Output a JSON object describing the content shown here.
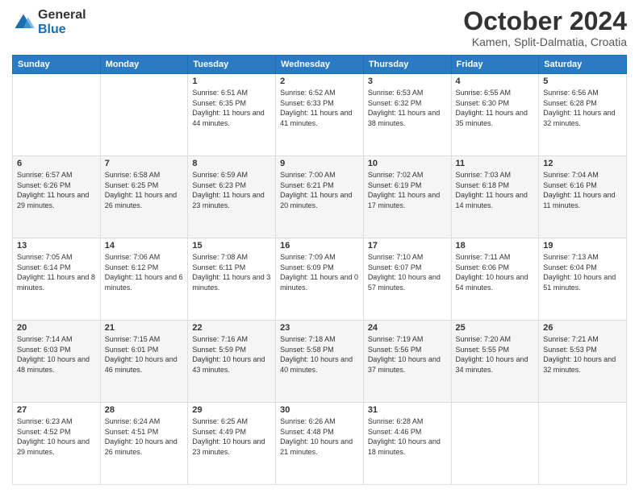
{
  "logo": {
    "general": "General",
    "blue": "Blue"
  },
  "header": {
    "month": "October 2024",
    "location": "Kamen, Split-Dalmatia, Croatia"
  },
  "days_of_week": [
    "Sunday",
    "Monday",
    "Tuesday",
    "Wednesday",
    "Thursday",
    "Friday",
    "Saturday"
  ],
  "weeks": [
    [
      {
        "day": "",
        "info": ""
      },
      {
        "day": "",
        "info": ""
      },
      {
        "day": "1",
        "info": "Sunrise: 6:51 AM\nSunset: 6:35 PM\nDaylight: 11 hours and 44 minutes."
      },
      {
        "day": "2",
        "info": "Sunrise: 6:52 AM\nSunset: 6:33 PM\nDaylight: 11 hours and 41 minutes."
      },
      {
        "day": "3",
        "info": "Sunrise: 6:53 AM\nSunset: 6:32 PM\nDaylight: 11 hours and 38 minutes."
      },
      {
        "day": "4",
        "info": "Sunrise: 6:55 AM\nSunset: 6:30 PM\nDaylight: 11 hours and 35 minutes."
      },
      {
        "day": "5",
        "info": "Sunrise: 6:56 AM\nSunset: 6:28 PM\nDaylight: 11 hours and 32 minutes."
      }
    ],
    [
      {
        "day": "6",
        "info": "Sunrise: 6:57 AM\nSunset: 6:26 PM\nDaylight: 11 hours and 29 minutes."
      },
      {
        "day": "7",
        "info": "Sunrise: 6:58 AM\nSunset: 6:25 PM\nDaylight: 11 hours and 26 minutes."
      },
      {
        "day": "8",
        "info": "Sunrise: 6:59 AM\nSunset: 6:23 PM\nDaylight: 11 hours and 23 minutes."
      },
      {
        "day": "9",
        "info": "Sunrise: 7:00 AM\nSunset: 6:21 PM\nDaylight: 11 hours and 20 minutes."
      },
      {
        "day": "10",
        "info": "Sunrise: 7:02 AM\nSunset: 6:19 PM\nDaylight: 11 hours and 17 minutes."
      },
      {
        "day": "11",
        "info": "Sunrise: 7:03 AM\nSunset: 6:18 PM\nDaylight: 11 hours and 14 minutes."
      },
      {
        "day": "12",
        "info": "Sunrise: 7:04 AM\nSunset: 6:16 PM\nDaylight: 11 hours and 11 minutes."
      }
    ],
    [
      {
        "day": "13",
        "info": "Sunrise: 7:05 AM\nSunset: 6:14 PM\nDaylight: 11 hours and 8 minutes."
      },
      {
        "day": "14",
        "info": "Sunrise: 7:06 AM\nSunset: 6:12 PM\nDaylight: 11 hours and 6 minutes."
      },
      {
        "day": "15",
        "info": "Sunrise: 7:08 AM\nSunset: 6:11 PM\nDaylight: 11 hours and 3 minutes."
      },
      {
        "day": "16",
        "info": "Sunrise: 7:09 AM\nSunset: 6:09 PM\nDaylight: 11 hours and 0 minutes."
      },
      {
        "day": "17",
        "info": "Sunrise: 7:10 AM\nSunset: 6:07 PM\nDaylight: 10 hours and 57 minutes."
      },
      {
        "day": "18",
        "info": "Sunrise: 7:11 AM\nSunset: 6:06 PM\nDaylight: 10 hours and 54 minutes."
      },
      {
        "day": "19",
        "info": "Sunrise: 7:13 AM\nSunset: 6:04 PM\nDaylight: 10 hours and 51 minutes."
      }
    ],
    [
      {
        "day": "20",
        "info": "Sunrise: 7:14 AM\nSunset: 6:03 PM\nDaylight: 10 hours and 48 minutes."
      },
      {
        "day": "21",
        "info": "Sunrise: 7:15 AM\nSunset: 6:01 PM\nDaylight: 10 hours and 46 minutes."
      },
      {
        "day": "22",
        "info": "Sunrise: 7:16 AM\nSunset: 5:59 PM\nDaylight: 10 hours and 43 minutes."
      },
      {
        "day": "23",
        "info": "Sunrise: 7:18 AM\nSunset: 5:58 PM\nDaylight: 10 hours and 40 minutes."
      },
      {
        "day": "24",
        "info": "Sunrise: 7:19 AM\nSunset: 5:56 PM\nDaylight: 10 hours and 37 minutes."
      },
      {
        "day": "25",
        "info": "Sunrise: 7:20 AM\nSunset: 5:55 PM\nDaylight: 10 hours and 34 minutes."
      },
      {
        "day": "26",
        "info": "Sunrise: 7:21 AM\nSunset: 5:53 PM\nDaylight: 10 hours and 32 minutes."
      }
    ],
    [
      {
        "day": "27",
        "info": "Sunrise: 6:23 AM\nSunset: 4:52 PM\nDaylight: 10 hours and 29 minutes."
      },
      {
        "day": "28",
        "info": "Sunrise: 6:24 AM\nSunset: 4:51 PM\nDaylight: 10 hours and 26 minutes."
      },
      {
        "day": "29",
        "info": "Sunrise: 6:25 AM\nSunset: 4:49 PM\nDaylight: 10 hours and 23 minutes."
      },
      {
        "day": "30",
        "info": "Sunrise: 6:26 AM\nSunset: 4:48 PM\nDaylight: 10 hours and 21 minutes."
      },
      {
        "day": "31",
        "info": "Sunrise: 6:28 AM\nSunset: 4:46 PM\nDaylight: 10 hours and 18 minutes."
      },
      {
        "day": "",
        "info": ""
      },
      {
        "day": "",
        "info": ""
      }
    ]
  ]
}
